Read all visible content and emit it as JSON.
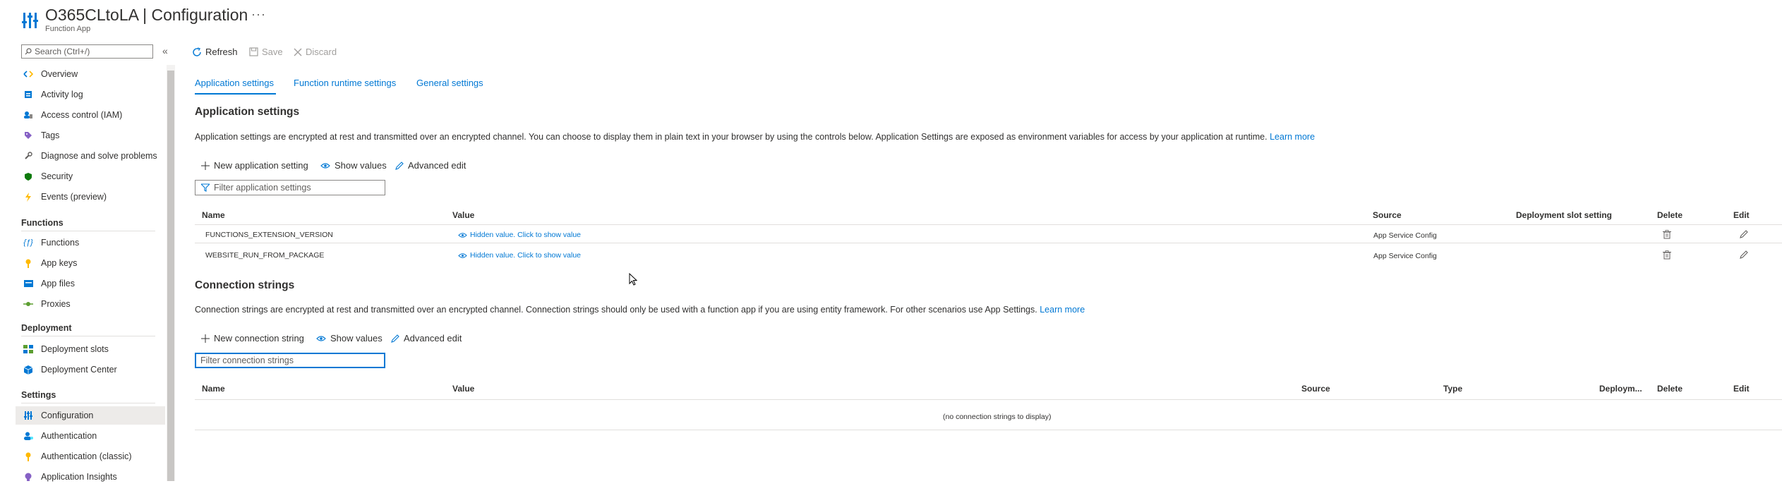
{
  "header": {
    "title": "O365CLtoLA | Configuration",
    "more": "···",
    "subtitle": "Function App"
  },
  "sidebar": {
    "search_placeholder": "Search (Ctrl+/)",
    "collapse": "«",
    "items": [
      {
        "label": "Overview",
        "icon": "overview-icon"
      },
      {
        "label": "Activity log",
        "icon": "activity-log-icon"
      },
      {
        "label": "Access control (IAM)",
        "icon": "iam-icon"
      },
      {
        "label": "Tags",
        "icon": "tag-icon"
      },
      {
        "label": "Diagnose and solve problems",
        "icon": "wrench-icon"
      },
      {
        "label": "Security",
        "icon": "shield-icon"
      },
      {
        "label": "Events (preview)",
        "icon": "lightning-icon"
      }
    ],
    "sections": [
      {
        "title": "Functions",
        "items": [
          {
            "label": "Functions",
            "icon": "function-icon"
          },
          {
            "label": "App keys",
            "icon": "key-icon"
          },
          {
            "label": "App files",
            "icon": "app-files-icon"
          },
          {
            "label": "Proxies",
            "icon": "proxy-icon"
          }
        ]
      },
      {
        "title": "Deployment",
        "items": [
          {
            "label": "Deployment slots",
            "icon": "slots-icon"
          },
          {
            "label": "Deployment Center",
            "icon": "cube-icon"
          }
        ]
      },
      {
        "title": "Settings",
        "items": [
          {
            "label": "Configuration",
            "icon": "sliders-icon",
            "active": true
          },
          {
            "label": "Authentication",
            "icon": "user-icon"
          },
          {
            "label": "Authentication (classic)",
            "icon": "key-icon"
          },
          {
            "label": "Application Insights",
            "icon": "bulb-icon"
          }
        ]
      }
    ]
  },
  "toolbar": {
    "refresh": "Refresh",
    "save": "Save",
    "discard": "Discard"
  },
  "tabs": [
    "Application settings",
    "Function runtime settings",
    "General settings"
  ],
  "app_settings": {
    "heading": "Application settings",
    "description": "Application settings are encrypted at rest and transmitted over an encrypted channel. You can choose to display them in plain text in your browser by using the controls below. Application Settings are exposed as environment variables for access by your application at runtime.",
    "learn_more": "Learn more",
    "new_label": "New application setting",
    "show_values": "Show values",
    "advanced_edit": "Advanced edit",
    "filter_placeholder": "Filter application settings",
    "columns": [
      "Name",
      "Value",
      "Source",
      "Deployment slot setting",
      "Delete",
      "Edit"
    ],
    "rows": [
      {
        "name": "FUNCTIONS_EXTENSION_VERSION",
        "value": "Hidden value. Click to show value",
        "source": "App Service Config"
      },
      {
        "name": "WEBSITE_RUN_FROM_PACKAGE",
        "value": "Hidden value. Click to show value",
        "source": "App Service Config"
      }
    ]
  },
  "conn_strings": {
    "heading": "Connection strings",
    "description": "Connection strings are encrypted at rest and transmitted over an encrypted channel. Connection strings should only be used with a function app if you are using entity framework. For other scenarios use App Settings.",
    "learn_more": "Learn more",
    "new_label": "New connection string",
    "show_values": "Show values",
    "advanced_edit": "Advanced edit",
    "filter_placeholder": "Filter connection strings",
    "columns": [
      "Name",
      "Value",
      "Source",
      "Type",
      "Deploym...",
      "Delete",
      "Edit"
    ],
    "empty": "(no connection strings to display)"
  },
  "colors": {
    "accent": "#0078d4",
    "active_bg": "#edebe9"
  }
}
